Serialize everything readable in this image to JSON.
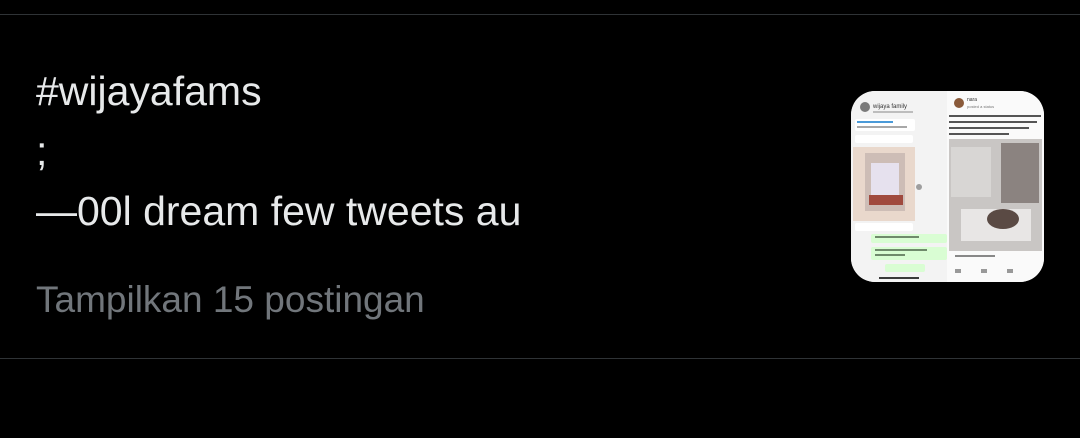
{
  "topic": {
    "line1": "#wijayafams",
    "line2": ";",
    "line3": "—00l dream few tweets au"
  },
  "show_more_label": "Tampilkan 15 postingan",
  "colors": {
    "background": "#000000",
    "primary_text": "#e7e9ea",
    "secondary_text": "#71767b",
    "divider": "#2f3336"
  },
  "thumbnail": {
    "left_panel_title": "wijaya family",
    "right_panel_title": "nara",
    "right_panel_subtitle": "posted a status"
  }
}
